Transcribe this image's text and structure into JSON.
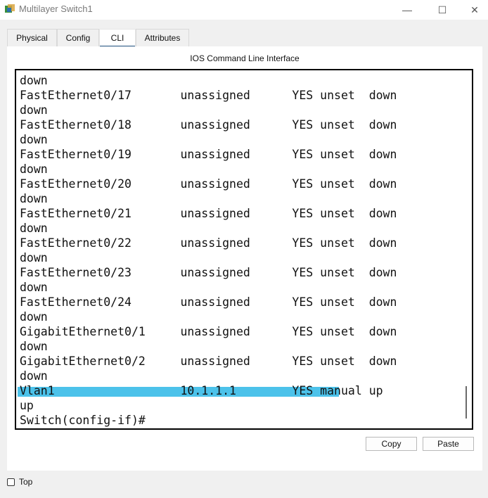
{
  "window": {
    "title": "Multilayer Switch1",
    "minimize_glyph": "—",
    "maximize_glyph": "☐",
    "close_glyph": "✕"
  },
  "tabs": [
    {
      "label": "Physical",
      "active": false
    },
    {
      "label": "Config",
      "active": false
    },
    {
      "label": "CLI",
      "active": true
    },
    {
      "label": "Attributes",
      "active": false
    }
  ],
  "panel": {
    "title": "IOS Command Line Interface"
  },
  "terminal": {
    "lines": [
      "down",
      "FastEthernet0/17       unassigned      YES unset  down",
      "down",
      "FastEthernet0/18       unassigned      YES unset  down",
      "down",
      "FastEthernet0/19       unassigned      YES unset  down",
      "down",
      "FastEthernet0/20       unassigned      YES unset  down",
      "down",
      "FastEthernet0/21       unassigned      YES unset  down",
      "down",
      "FastEthernet0/22       unassigned      YES unset  down",
      "down",
      "FastEthernet0/23       unassigned      YES unset  down",
      "down",
      "FastEthernet0/24       unassigned      YES unset  down",
      "down",
      "GigabitEthernet0/1     unassigned      YES unset  down",
      "down",
      "GigabitEthernet0/2     unassigned      YES unset  down",
      "down",
      "Vlan1                  10.1.1.1        YES manual up",
      "up",
      "Switch(config-if)#"
    ]
  },
  "buttons": {
    "copy": "Copy",
    "paste": "Paste"
  },
  "top_checkbox": {
    "label": "Top",
    "checked": false
  },
  "colors": {
    "highlight": "#4cc2ea",
    "active_tab_underline": "#1c4c7c"
  }
}
